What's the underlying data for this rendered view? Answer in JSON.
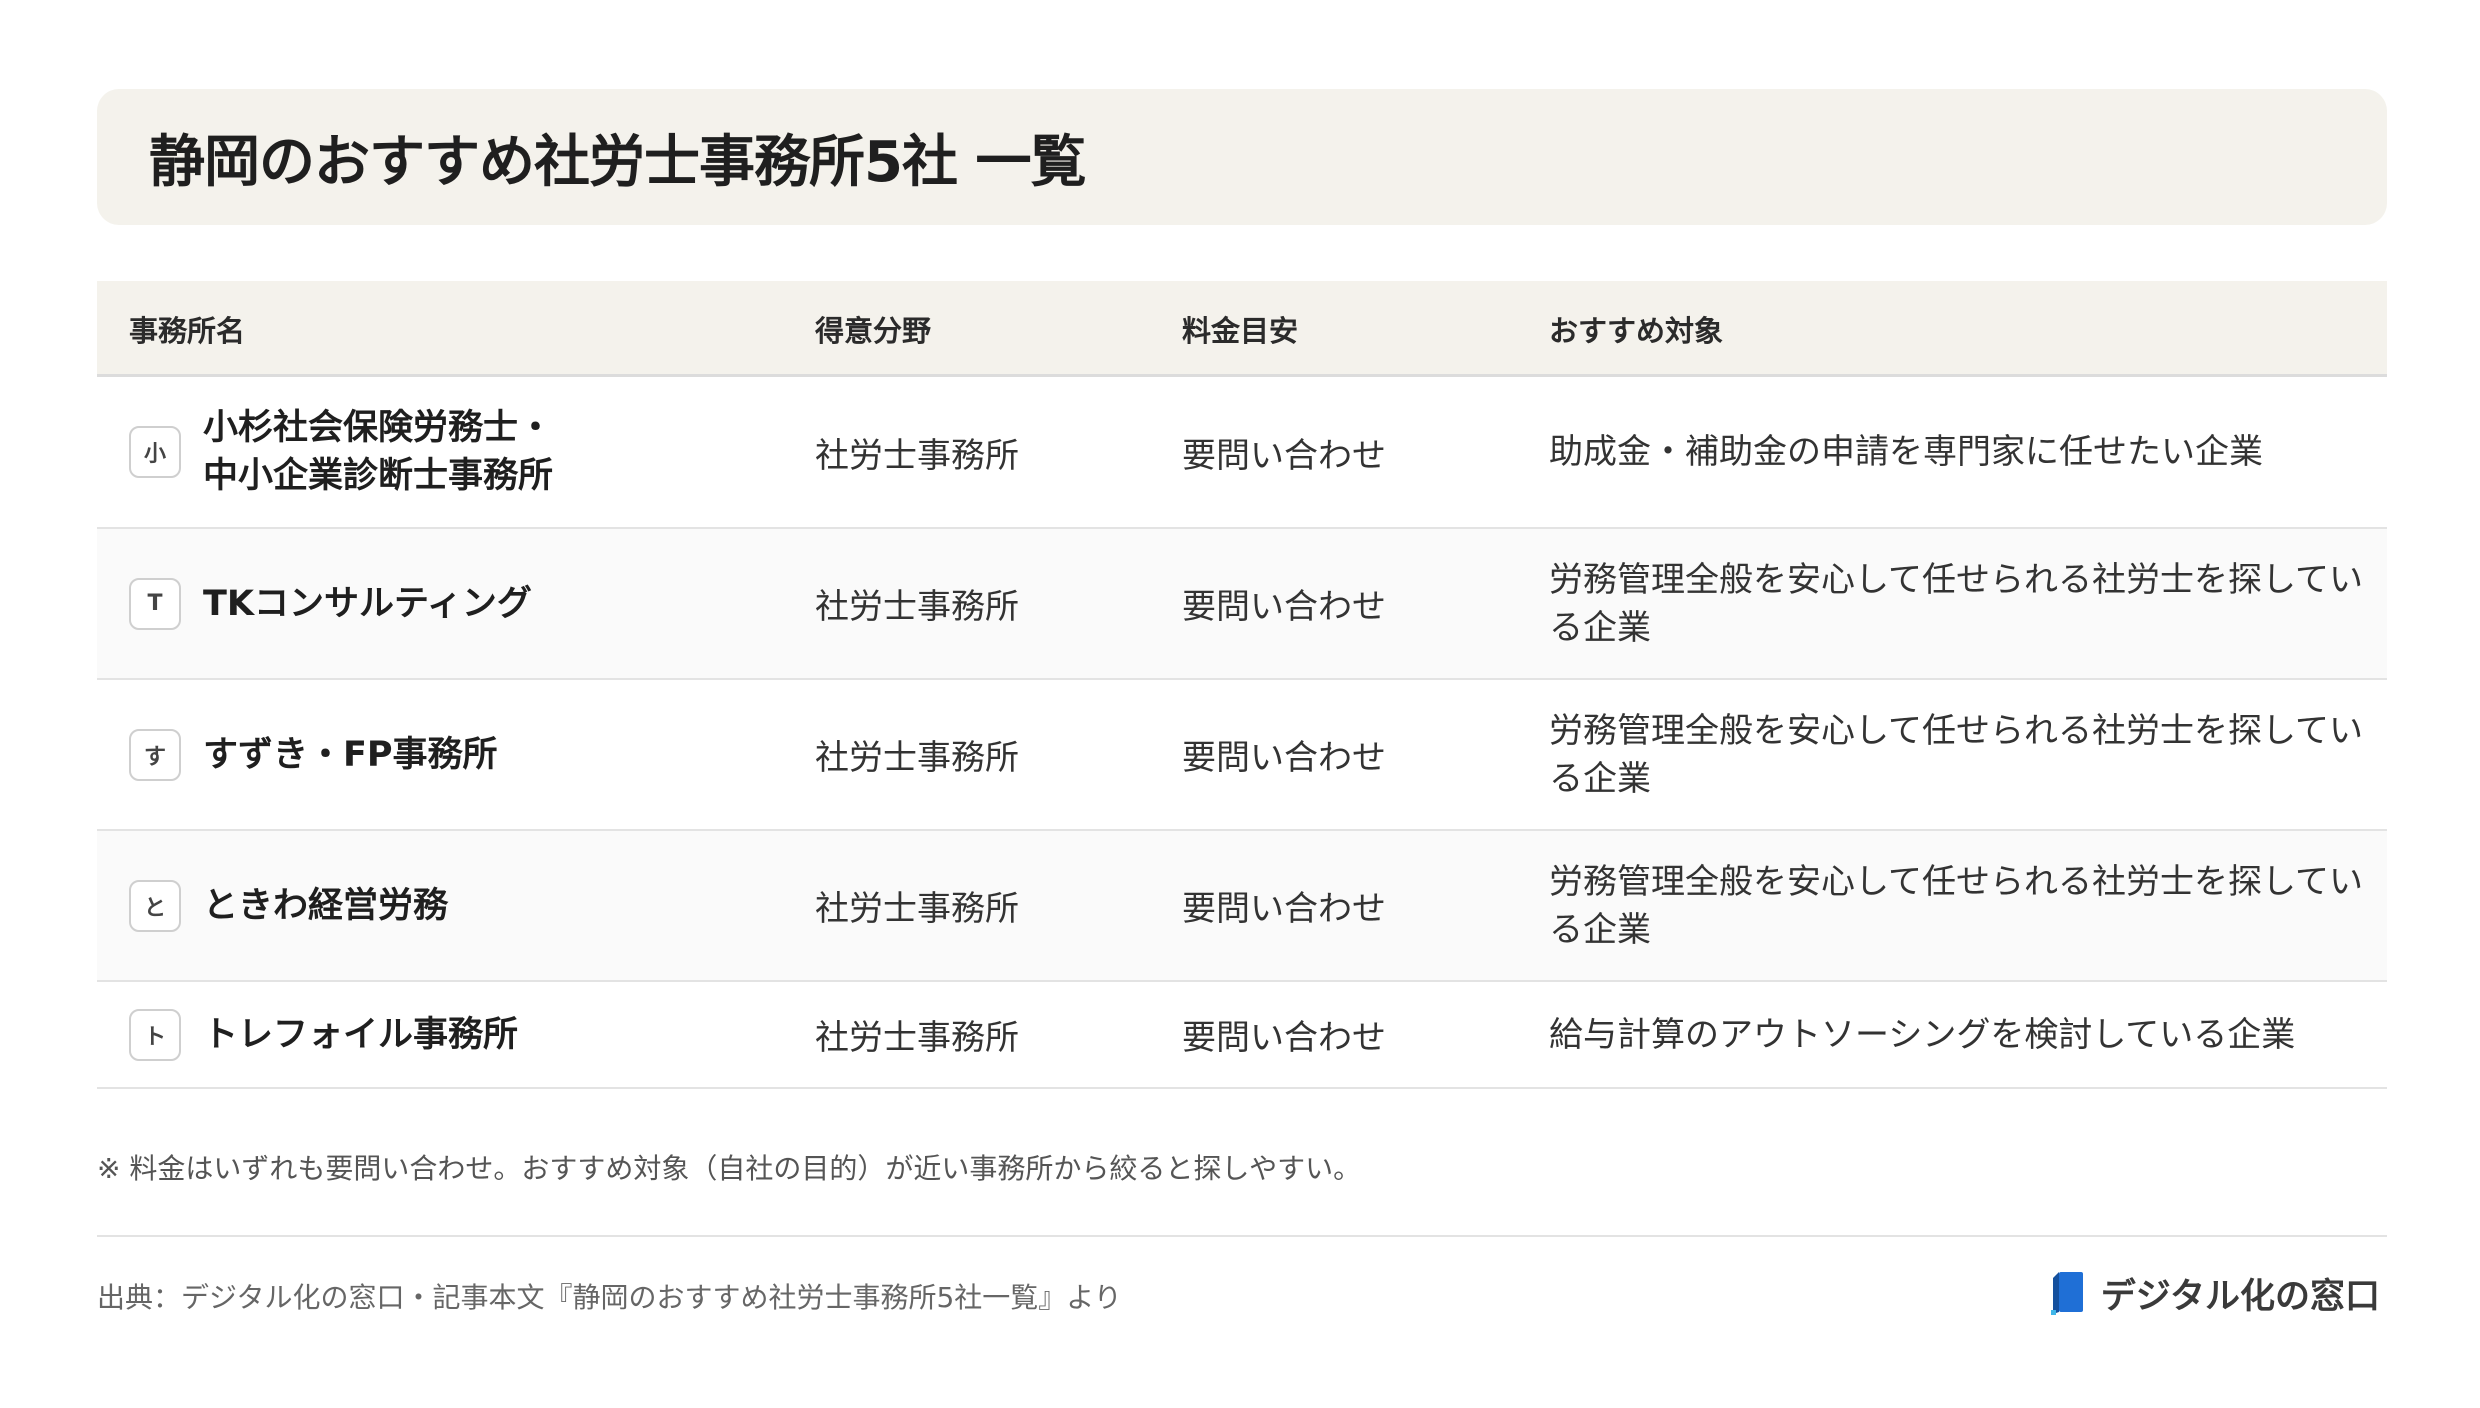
{
  "title": "静岡のおすすめ社労士事務所5社 一覧",
  "table": {
    "headers": [
      "事務所名",
      "得意分野",
      "料金目安",
      "おすすめ対象"
    ],
    "rows": [
      {
        "badge": "小",
        "name": "小杉社会保険労務士・\n中小企業診断士事務所",
        "field": "社労士事務所",
        "fee": "要問い合わせ",
        "target": "助成金・補助金の申請を専門家に任せたい企業"
      },
      {
        "badge": "T",
        "name": "TKコンサルティング",
        "field": "社労士事務所",
        "fee": "要問い合わせ",
        "target": "労務管理全般を安心して任せられる社労士を探している企業"
      },
      {
        "badge": "す",
        "name": "すずき・FP事務所",
        "field": "社労士事務所",
        "fee": "要問い合わせ",
        "target": "労務管理全般を安心して任せられる社労士を探している企業"
      },
      {
        "badge": "と",
        "name": "ときわ経営労務",
        "field": "社労士事務所",
        "fee": "要問い合わせ",
        "target": "労務管理全般を安心して任せられる社労士を探している企業"
      },
      {
        "badge": "ト",
        "name": "トレフォイル事務所",
        "field": "社労士事務所",
        "fee": "要問い合わせ",
        "target": "給与計算のアウトソーシングを検討している企業"
      }
    ]
  },
  "note": "※ 料金はいずれも要問い合わせ。おすすめ対象（自社の目的）が近い事務所から絞ると探しやすい。",
  "source": "出典：デジタル化の窓口・記事本文『静岡のおすすめ社労士事務所5社一覧』より",
  "logo": {
    "text": "デジタル化の窓口",
    "icon": "document-logo-icon",
    "accent": "#1f6fd6"
  }
}
